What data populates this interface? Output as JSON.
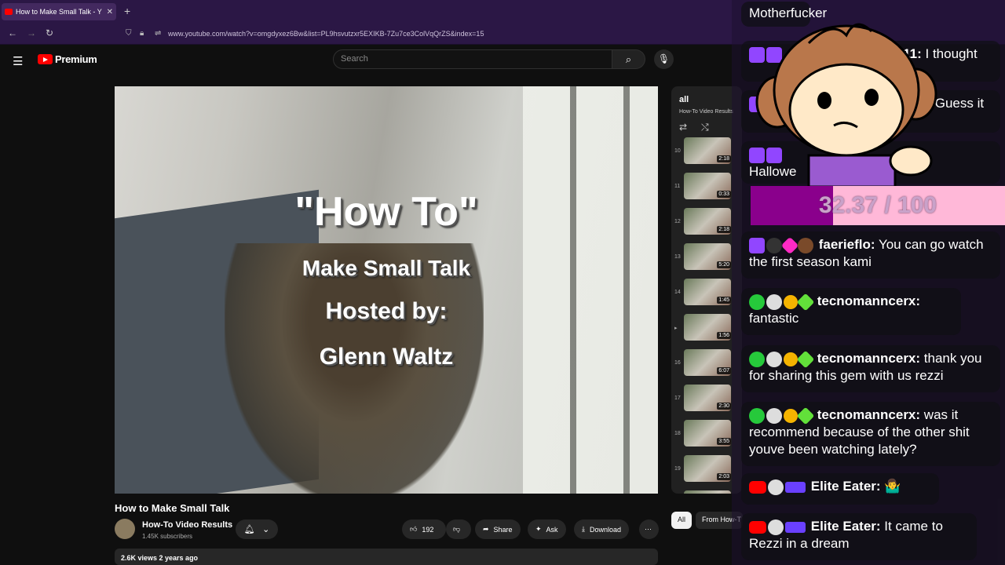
{
  "browser": {
    "tab_title": "How to Make Small Talk - Y",
    "tab_close": "✕",
    "new_tab": "+",
    "url": "www.youtube.com/watch?v=omgdyxez6Bw&list=PL9hsvutzxr5EXIKB-7Zu7ce3ColVqQrZS&index=15",
    "nav": {
      "back": "←",
      "forward": "→",
      "reload": "↻"
    }
  },
  "youtube": {
    "logo_text": "Premium",
    "search_placeholder": "Search",
    "video_overlay": {
      "line1": "\"How To\"",
      "line2": "Make Small Talk",
      "line3": "Hosted by:",
      "line4": "Glenn Waltz"
    },
    "video_title": "How to Make Small Talk",
    "channel": {
      "name": "How-To Video Results",
      "subscribers": "1.45K subscribers"
    },
    "actions": {
      "likes": "192",
      "share": "Share",
      "ask": "Ask",
      "download": "Download",
      "more": "⋯"
    },
    "description_meta": "2.6K views  2 years ago",
    "playlist": {
      "title": "all",
      "subtitle": "How-To Video Results",
      "items": [
        {
          "num": "10",
          "duration": "2:18"
        },
        {
          "num": "11",
          "duration": "0:33"
        },
        {
          "num": "12",
          "duration": "2:18"
        },
        {
          "num": "13",
          "duration": "5:20"
        },
        {
          "num": "14",
          "duration": "1:45"
        },
        {
          "num": "▸",
          "duration": "1:56"
        },
        {
          "num": "16",
          "duration": "6:07"
        },
        {
          "num": "17",
          "duration": "2:30"
        },
        {
          "num": "18",
          "duration": "3:55"
        },
        {
          "num": "19",
          "duration": "2:03"
        },
        {
          "num": "20",
          "duration": ""
        }
      ]
    },
    "chips": [
      {
        "label": "All"
      },
      {
        "label": "From How-T"
      }
    ]
  },
  "chat": {
    "gauge": {
      "text": "32.37 / 100",
      "value": 32.37,
      "max": 100
    },
    "messages": [
      {
        "name": "",
        "text": "Motherfucker"
      },
      {
        "name": "ze411:",
        "text": " I thought"
      },
      {
        "name": "",
        "text": "Guess it"
      },
      {
        "name": ":",
        "text": "Hallowe"
      },
      {
        "name": "faerieflo:",
        "text": " You can go watch the first season kami"
      },
      {
        "name": "tecnomanncerx:",
        "text": " fantastic"
      },
      {
        "name": "tecnomanncerx:",
        "text": " thank you for sharing this gem with us rezzi"
      },
      {
        "name": "tecnomanncerx:",
        "text": " was it recommend because of the other shit youve been watching lately?"
      },
      {
        "name": "Elite Eater:",
        "text": " 🤷‍♂️"
      },
      {
        "name": "Elite Eater:",
        "text": " It came to Rezzi in a dream"
      }
    ]
  }
}
